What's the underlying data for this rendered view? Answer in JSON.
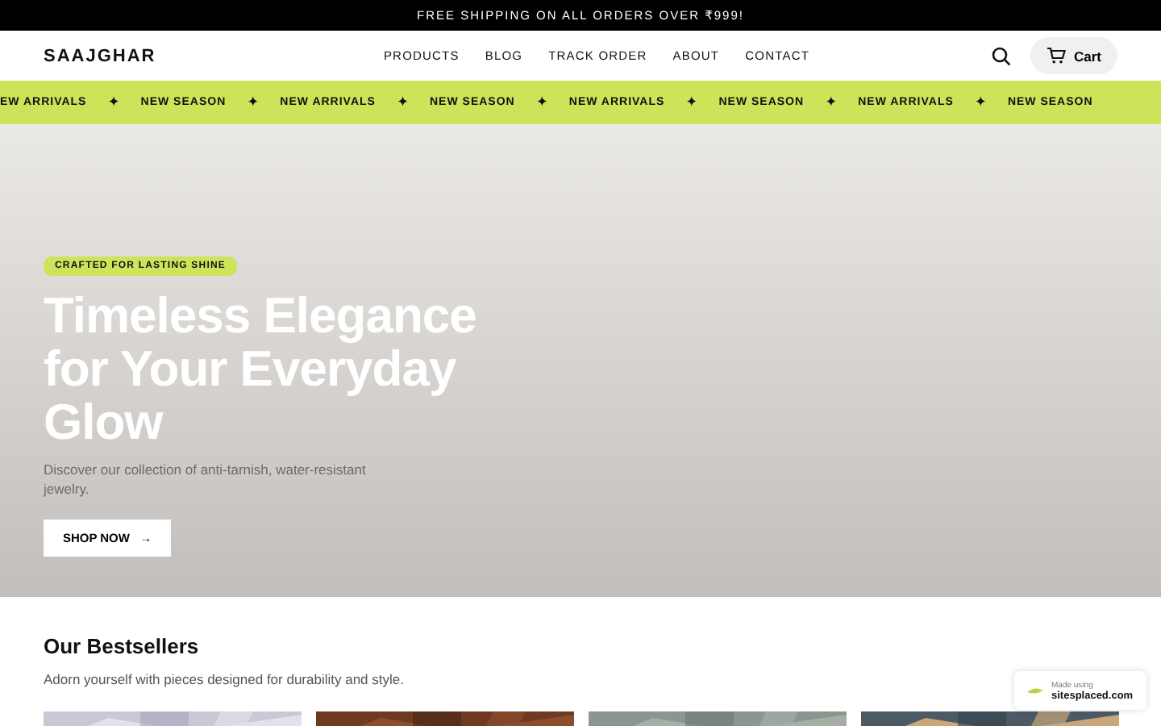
{
  "announcement": "FREE SHIPPING ON ALL ORDERS OVER ₹999!",
  "header": {
    "logo": "SAAJGHAR",
    "nav": [
      "PRODUCTS",
      "BLOG",
      "TRACK ORDER",
      "ABOUT",
      "CONTACT"
    ],
    "cart": "Cart"
  },
  "marquee": [
    {
      "kind": "text",
      "text": "EW ARRIVALS"
    },
    {
      "kind": "star",
      "text": "✦"
    },
    {
      "kind": "text",
      "text": "NEW SEASON"
    },
    {
      "kind": "star",
      "text": "✦"
    },
    {
      "kind": "text",
      "text": "NEW ARRIVALS"
    },
    {
      "kind": "star",
      "text": "✦"
    },
    {
      "kind": "text",
      "text": "NEW SEASON"
    },
    {
      "kind": "star",
      "text": "✦"
    },
    {
      "kind": "text",
      "text": "NEW ARRIVALS"
    },
    {
      "kind": "star",
      "text": "✦"
    },
    {
      "kind": "text",
      "text": "NEW SEASON"
    },
    {
      "kind": "star",
      "text": "✦"
    },
    {
      "kind": "text",
      "text": "NEW ARRIVALS"
    },
    {
      "kind": "star",
      "text": "✦"
    },
    {
      "kind": "text",
      "text": "NEW SEASON"
    }
  ],
  "hero": {
    "badge": "CRAFTED FOR LASTING SHINE",
    "title": "Timeless Elegance for Your Everyday Glow",
    "subtitle": "Discover our collection of anti-tarnish, water-resistant jewelry.",
    "button": "SHOP NOW",
    "button_arrow": "→"
  },
  "bestsellers": {
    "title": "Our Bestsellers",
    "subtitle": "Adorn yourself with pieces designed for durability and style."
  },
  "builder_badge": {
    "label": "Made using",
    "site": "sitesplaced.com"
  }
}
